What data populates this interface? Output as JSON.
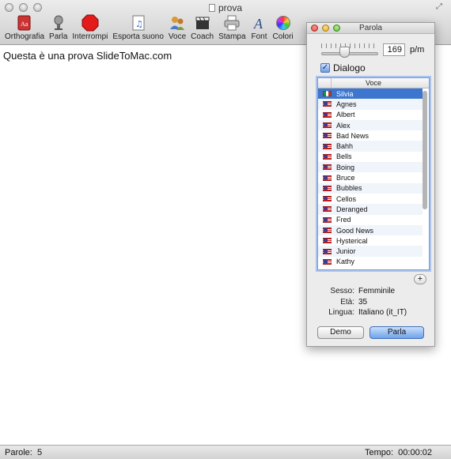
{
  "window": {
    "title": "prova"
  },
  "toolbar": {
    "items": [
      {
        "label": "Orthografia",
        "icon": "dictionary-icon"
      },
      {
        "label": "Parla",
        "icon": "microphone-icon"
      },
      {
        "label": "Interrompi",
        "icon": "stop-sign-icon"
      },
      {
        "label": "Esporta suono",
        "icon": "music-file-icon"
      },
      {
        "label": "Voce",
        "icon": "people-icon"
      },
      {
        "label": "Coach",
        "icon": "clapperboard-icon"
      },
      {
        "label": "Stampa",
        "icon": "printer-icon"
      },
      {
        "label": "Font",
        "icon": "font-icon"
      },
      {
        "label": "Colori",
        "icon": "color-wheel-icon"
      }
    ]
  },
  "document": {
    "text": "Questa è una prova SlideToMac.com"
  },
  "status": {
    "words_label": "Parole:",
    "words_value": "5",
    "time_label": "Tempo:",
    "time_value": "00:00:02"
  },
  "panel": {
    "title": "Parola",
    "speed_value": "169",
    "speed_unit": "p/m",
    "speed_slider_fraction": 0.4,
    "dialog_label": "Dialogo",
    "dialog_checked": true,
    "voice_header": "Voce",
    "voices": [
      {
        "name": "Silvia",
        "flag": "it",
        "selected": true
      },
      {
        "name": "Agnes",
        "flag": "us"
      },
      {
        "name": "Albert",
        "flag": "us"
      },
      {
        "name": "Alex",
        "flag": "us"
      },
      {
        "name": "Bad News",
        "flag": "us"
      },
      {
        "name": "Bahh",
        "flag": "us"
      },
      {
        "name": "Bells",
        "flag": "us"
      },
      {
        "name": "Boing",
        "flag": "us"
      },
      {
        "name": "Bruce",
        "flag": "us"
      },
      {
        "name": "Bubbles",
        "flag": "us"
      },
      {
        "name": "Cellos",
        "flag": "us"
      },
      {
        "name": "Deranged",
        "flag": "us"
      },
      {
        "name": "Fred",
        "flag": "us"
      },
      {
        "name": "Good News",
        "flag": "us"
      },
      {
        "name": "Hysterical",
        "flag": "us"
      },
      {
        "name": "Junior",
        "flag": "us"
      },
      {
        "name": "Kathy",
        "flag": "us"
      }
    ],
    "add_label": "+",
    "info": [
      {
        "key": "Sesso:",
        "value": "Femminile"
      },
      {
        "key": "Età:",
        "value": "35"
      },
      {
        "key": "Lingua:",
        "value": "Italiano (it_IT)"
      }
    ],
    "demo_label": "Demo",
    "parla_label": "Parla"
  },
  "colors": {
    "selection": "#3d76cf",
    "accent_button": "#6fa3ea"
  }
}
